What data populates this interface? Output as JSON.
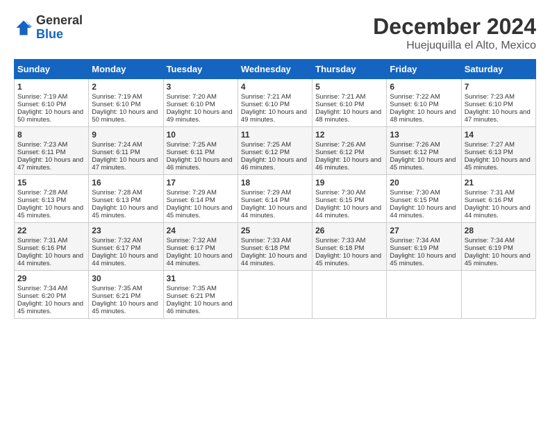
{
  "header": {
    "logo_general": "General",
    "logo_blue": "Blue",
    "title": "December 2024",
    "subtitle": "Huejuquilla el Alto, Mexico"
  },
  "days_header": [
    "Sunday",
    "Monday",
    "Tuesday",
    "Wednesday",
    "Thursday",
    "Friday",
    "Saturday"
  ],
  "weeks": [
    [
      {
        "day": "1",
        "sunrise": "7:19 AM",
        "sunset": "6:10 PM",
        "daylight": "10 hours and 50 minutes."
      },
      {
        "day": "2",
        "sunrise": "7:19 AM",
        "sunset": "6:10 PM",
        "daylight": "10 hours and 50 minutes."
      },
      {
        "day": "3",
        "sunrise": "7:20 AM",
        "sunset": "6:10 PM",
        "daylight": "10 hours and 49 minutes."
      },
      {
        "day": "4",
        "sunrise": "7:21 AM",
        "sunset": "6:10 PM",
        "daylight": "10 hours and 49 minutes."
      },
      {
        "day": "5",
        "sunrise": "7:21 AM",
        "sunset": "6:10 PM",
        "daylight": "10 hours and 48 minutes."
      },
      {
        "day": "6",
        "sunrise": "7:22 AM",
        "sunset": "6:10 PM",
        "daylight": "10 hours and 48 minutes."
      },
      {
        "day": "7",
        "sunrise": "7:23 AM",
        "sunset": "6:10 PM",
        "daylight": "10 hours and 47 minutes."
      }
    ],
    [
      {
        "day": "8",
        "sunrise": "7:23 AM",
        "sunset": "6:11 PM",
        "daylight": "10 hours and 47 minutes."
      },
      {
        "day": "9",
        "sunrise": "7:24 AM",
        "sunset": "6:11 PM",
        "daylight": "10 hours and 47 minutes."
      },
      {
        "day": "10",
        "sunrise": "7:25 AM",
        "sunset": "6:11 PM",
        "daylight": "10 hours and 46 minutes."
      },
      {
        "day": "11",
        "sunrise": "7:25 AM",
        "sunset": "6:12 PM",
        "daylight": "10 hours and 46 minutes."
      },
      {
        "day": "12",
        "sunrise": "7:26 AM",
        "sunset": "6:12 PM",
        "daylight": "10 hours and 46 minutes."
      },
      {
        "day": "13",
        "sunrise": "7:26 AM",
        "sunset": "6:12 PM",
        "daylight": "10 hours and 45 minutes."
      },
      {
        "day": "14",
        "sunrise": "7:27 AM",
        "sunset": "6:13 PM",
        "daylight": "10 hours and 45 minutes."
      }
    ],
    [
      {
        "day": "15",
        "sunrise": "7:28 AM",
        "sunset": "6:13 PM",
        "daylight": "10 hours and 45 minutes."
      },
      {
        "day": "16",
        "sunrise": "7:28 AM",
        "sunset": "6:13 PM",
        "daylight": "10 hours and 45 minutes."
      },
      {
        "day": "17",
        "sunrise": "7:29 AM",
        "sunset": "6:14 PM",
        "daylight": "10 hours and 45 minutes."
      },
      {
        "day": "18",
        "sunrise": "7:29 AM",
        "sunset": "6:14 PM",
        "daylight": "10 hours and 44 minutes."
      },
      {
        "day": "19",
        "sunrise": "7:30 AM",
        "sunset": "6:15 PM",
        "daylight": "10 hours and 44 minutes."
      },
      {
        "day": "20",
        "sunrise": "7:30 AM",
        "sunset": "6:15 PM",
        "daylight": "10 hours and 44 minutes."
      },
      {
        "day": "21",
        "sunrise": "7:31 AM",
        "sunset": "6:16 PM",
        "daylight": "10 hours and 44 minutes."
      }
    ],
    [
      {
        "day": "22",
        "sunrise": "7:31 AM",
        "sunset": "6:16 PM",
        "daylight": "10 hours and 44 minutes."
      },
      {
        "day": "23",
        "sunrise": "7:32 AM",
        "sunset": "6:17 PM",
        "daylight": "10 hours and 44 minutes."
      },
      {
        "day": "24",
        "sunrise": "7:32 AM",
        "sunset": "6:17 PM",
        "daylight": "10 hours and 44 minutes."
      },
      {
        "day": "25",
        "sunrise": "7:33 AM",
        "sunset": "6:18 PM",
        "daylight": "10 hours and 44 minutes."
      },
      {
        "day": "26",
        "sunrise": "7:33 AM",
        "sunset": "6:18 PM",
        "daylight": "10 hours and 45 minutes."
      },
      {
        "day": "27",
        "sunrise": "7:34 AM",
        "sunset": "6:19 PM",
        "daylight": "10 hours and 45 minutes."
      },
      {
        "day": "28",
        "sunrise": "7:34 AM",
        "sunset": "6:19 PM",
        "daylight": "10 hours and 45 minutes."
      }
    ],
    [
      {
        "day": "29",
        "sunrise": "7:34 AM",
        "sunset": "6:20 PM",
        "daylight": "10 hours and 45 minutes."
      },
      {
        "day": "30",
        "sunrise": "7:35 AM",
        "sunset": "6:21 PM",
        "daylight": "10 hours and 45 minutes."
      },
      {
        "day": "31",
        "sunrise": "7:35 AM",
        "sunset": "6:21 PM",
        "daylight": "10 hours and 46 minutes."
      },
      null,
      null,
      null,
      null
    ]
  ]
}
